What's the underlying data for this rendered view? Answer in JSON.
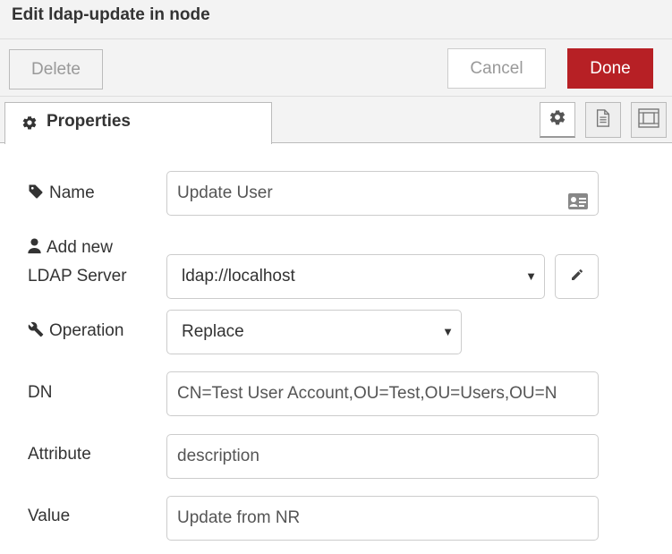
{
  "dialog": {
    "title": "Edit ldap-update in node"
  },
  "toolbar": {
    "delete_label": "Delete",
    "cancel_label": "Cancel",
    "done_label": "Done",
    "done_color": "#b72025"
  },
  "tabs": {
    "properties_label": "Properties",
    "icons": [
      "gear-icon",
      "file-text-icon",
      "frame-icon"
    ]
  },
  "form": {
    "name": {
      "label": "Name",
      "value": "Update User",
      "icon": "tag-icon"
    },
    "server": {
      "label_line1": "Add new",
      "label_line2": "LDAP Server",
      "value": "ldap://localhost",
      "icon": "user-icon"
    },
    "operation": {
      "label": "Operation",
      "value": "Replace",
      "icon": "wrench-icon"
    },
    "dn": {
      "label": "DN",
      "value": "CN=Test User Account,OU=Test,OU=Users,OU=N"
    },
    "attribute": {
      "label": "Attribute",
      "value": "description"
    },
    "value": {
      "label": "Value",
      "value": "Update from NR"
    }
  }
}
